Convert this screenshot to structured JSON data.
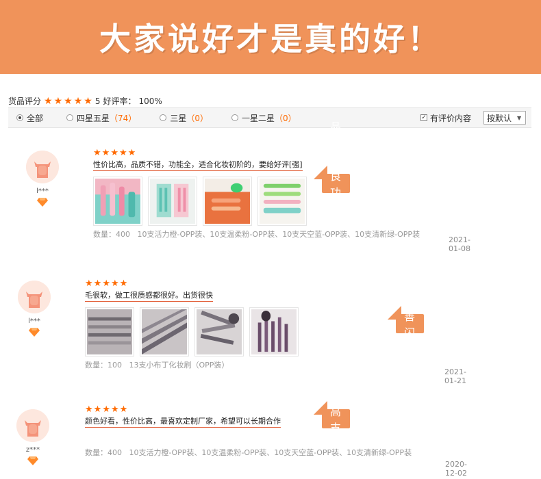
{
  "banner": {
    "title": "大家说好才是真的好！"
  },
  "colors": {
    "accent": "#f0935a",
    "star": "#ff6a00"
  },
  "summary": {
    "label": "货品评分",
    "stars": 5,
    "score": "5",
    "rate_label": "好评率：",
    "rate_value": "100%"
  },
  "filters": {
    "options": [
      {
        "label": "全部",
        "count": "",
        "selected": true
      },
      {
        "label": "四星五星",
        "count": "（74）",
        "selected": false
      },
      {
        "label": "三星",
        "count": "（0）",
        "selected": false
      },
      {
        "label": "一星二星",
        "count": "（0）",
        "selected": false
      }
    ],
    "has_content_label": "有评价内容",
    "has_content_checked": true,
    "sort_value": "按默认"
  },
  "reviews": [
    {
      "user": "l***",
      "stars": 5,
      "text": "性价比高，品质不错，功能全，适合化妆初阶的，要给好评[强]",
      "photos": [
        "teal-brush-set",
        "pink-mint-case",
        "orange-brushes",
        "green-brushes"
      ],
      "meta_qty": "数量：400",
      "meta_variant": "10支活力橙-OPP装、10支温柔粉-OPP装、10支天空蓝-OPP装、10支清新绿-OPP装",
      "date": "2021-01-08",
      "callout": "品质优良 功能齐全"
    },
    {
      "user": "l***",
      "stars": 5,
      "text": "毛很软，做工很质感都很好。出货很快",
      "photos": [
        "grey-brushes-fan",
        "grey-brushes-close",
        "grey-brushes-pile",
        "purple-brushes"
      ],
      "meta_qty": "数量：100",
      "meta_variant": "13支小布丁化妆刷（OPP装）",
      "date": "2021-01-21",
      "callout": "售后完善 闪电发货"
    },
    {
      "user": "z***",
      "stars": 5,
      "text": "颜色好看，性价比高，最喜欢定制厂家，希望可以长期合作",
      "photos": [],
      "meta_qty": "数量：400",
      "meta_variant": "10支活力橙-OPP装、10支温柔粉-OPP装、10支天空蓝-OPP装、10支清新绿-OPP装",
      "date": "2020-12-02",
      "callout": "性价比高 支持定制"
    }
  ]
}
